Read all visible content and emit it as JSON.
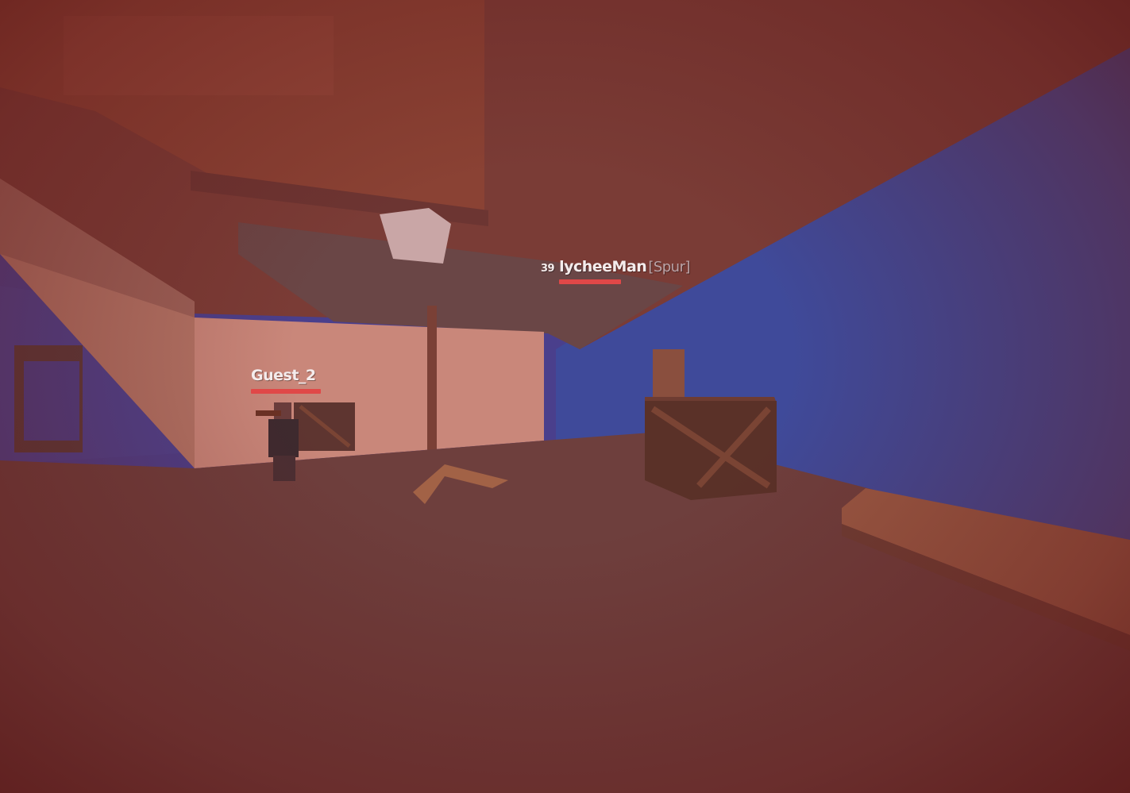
{
  "players": [
    {
      "level": "",
      "name": "Guest_2",
      "clan": "",
      "health_fraction": 1.0,
      "healthbar_color": "#e04848"
    },
    {
      "level": "39",
      "name": "lycheeMan",
      "clan": "[Spur]",
      "health_fraction": 1.0,
      "healthbar_color": "#e04848"
    }
  ],
  "colors": {
    "damage_tint": "#8a2a2a",
    "sky": "#4a3a8a",
    "floor": "#6e3f3d",
    "wall": "#c9877a",
    "crate": "#5a3128"
  }
}
